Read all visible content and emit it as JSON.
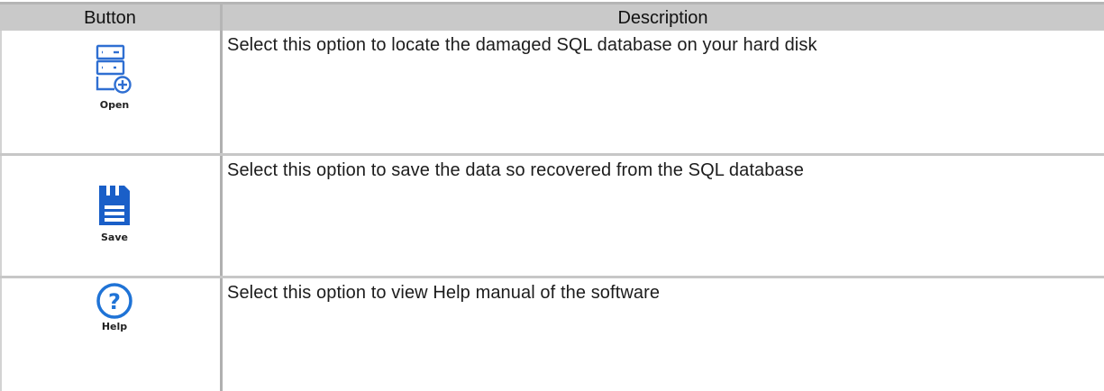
{
  "table": {
    "header": {
      "button": "Button",
      "description": "Description"
    },
    "rows": [
      {
        "icon": "open-database-icon",
        "label": "Open",
        "description": "Select this option to locate the damaged SQL database on your hard disk"
      },
      {
        "icon": "save-floppy-icon",
        "label": "Save",
        "description": "Select this option to save the data so recovered from the SQL database"
      },
      {
        "icon": "help-question-icon",
        "label": "Help",
        "description": "Select this option to view Help manual of the software"
      }
    ]
  },
  "colors": {
    "header_bg": "#c9c9c9",
    "icon_blue": "#1f6fd0",
    "save_blue": "#1a5fc8"
  }
}
